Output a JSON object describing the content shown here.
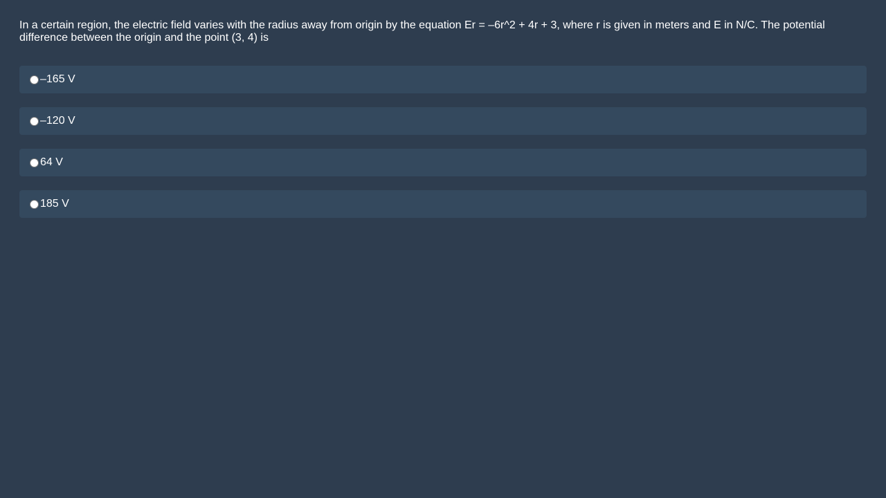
{
  "question": {
    "text": "In a certain region, the electric field varies with the radius away from origin by the equation Er = –6r^2 + 4r + 3, where r is given in meters and E in N/C. The potential difference between the origin and the point (3, 4) is"
  },
  "options": [
    {
      "label": "–165 V",
      "selected": false
    },
    {
      "label": "–120 V",
      "selected": false
    },
    {
      "label": "64 V",
      "selected": false
    },
    {
      "label": "185 V",
      "selected": false
    }
  ],
  "colors": {
    "background": "#2e3d4f",
    "option_background": "#34495e",
    "text": "#ffffff"
  }
}
